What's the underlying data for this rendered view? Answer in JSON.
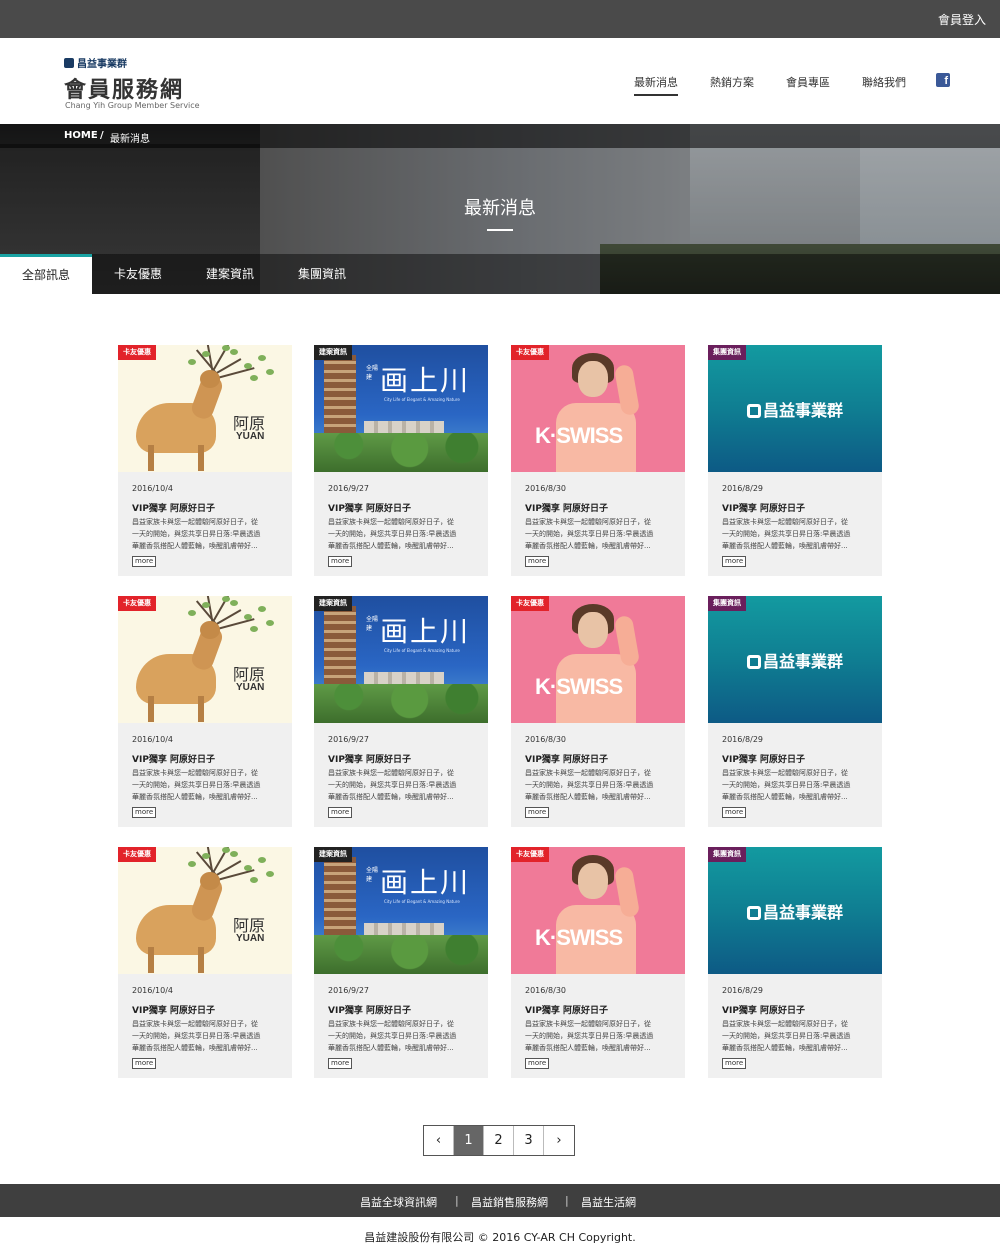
{
  "topbar": {
    "login": "會員登入"
  },
  "header": {
    "brand_small": "昌益事業群",
    "brand_big": "會員服務網",
    "brand_en": "Chang Yih Group Member Service",
    "nav": [
      "最新消息",
      "熱銷方案",
      "會員專區",
      "聯絡我們"
    ],
    "active_nav": "最新消息",
    "facebook_icon": "facebook-icon"
  },
  "hero": {
    "breadcrumb": {
      "home": "HOME",
      "sep": "/",
      "current": "最新消息"
    },
    "title": "最新消息",
    "tabs": [
      "全部訊息",
      "卡友優惠",
      "建案資訊",
      "集團資訊"
    ],
    "active_tab": "全部訊息",
    "tab_accent": "#1aa3a3"
  },
  "cards": {
    "more_label": "more",
    "excerpt_lines": [
      "昌益家族卡與您一起體驗阿原好日子，從",
      "一天的開始，與您共享日昇日落:早晨透過",
      "華麗香氛搭配人體藍輪，喚醒肌膚帶好..."
    ],
    "title": "VIP獨享 阿原好日子",
    "columns": [
      {
        "badge": "卡友優惠",
        "badge_color": "#e2232a",
        "date": "2016/10/4",
        "thumb": "yuan"
      },
      {
        "badge": "建案資訊",
        "badge_color": "#222222",
        "date": "2016/9/27",
        "thumb": "river"
      },
      {
        "badge": "卡友優惠",
        "badge_color": "#e2232a",
        "date": "2016/8/30",
        "thumb": "kswiss"
      },
      {
        "badge": "集團資訊",
        "badge_color": "#6a1f5c",
        "date": "2016/8/29",
        "thumb": "group"
      }
    ]
  },
  "thumbs": {
    "yuan_cn": "阿原",
    "yuan_en": "YUAN",
    "river_title": "画上川",
    "river_logo": "全陽建",
    "river_sub": "City Life of Elegant & Amazing Nature",
    "kswiss_text": "K·SWISS",
    "group_text": "昌益事業群"
  },
  "pagination": {
    "prev": "‹",
    "pages": [
      "1",
      "2",
      "3"
    ],
    "current": "1",
    "next": "›"
  },
  "footer": {
    "links": [
      "昌益全球資訊網",
      "昌益銷售服務網",
      "昌益生活網"
    ],
    "separator": "|",
    "copyright": "昌益建設股份有限公司 © 2016 CY-AR CH Copyright."
  }
}
